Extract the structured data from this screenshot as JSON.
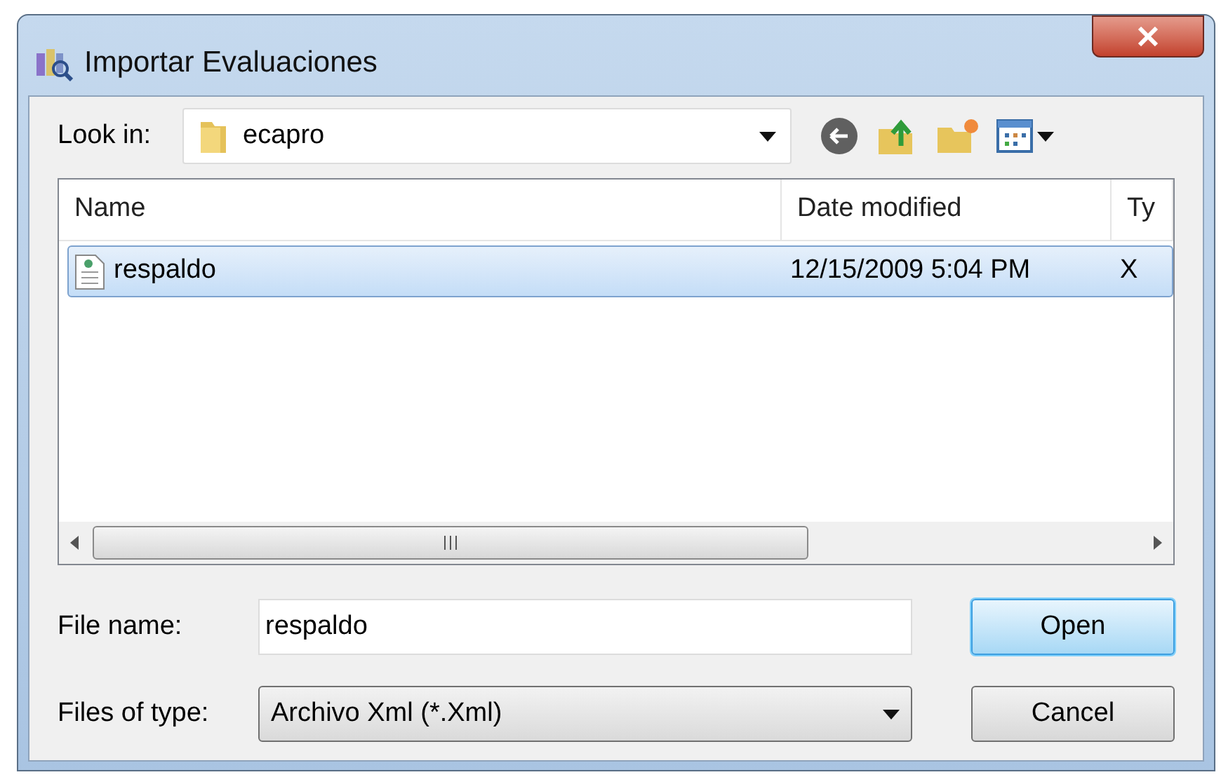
{
  "window": {
    "title": "Importar Evaluaciones"
  },
  "look_in": {
    "label": "Look in:",
    "value": "ecapro"
  },
  "file_list": {
    "columns": [
      "Name",
      "Date modified",
      "Ty"
    ],
    "rows": [
      {
        "name": "respaldo",
        "date_modified": "12/15/2009 5:04 PM",
        "column_3": "X",
        "selected": true
      }
    ]
  },
  "file_name": {
    "label": "File name:",
    "value": "respaldo"
  },
  "files_of_type": {
    "label": "Files of type:",
    "value": "Archivo Xml (*.Xml)"
  },
  "buttons": [
    {
      "label": "Open",
      "default": true
    },
    {
      "label": "Cancel",
      "default": false
    }
  ]
}
